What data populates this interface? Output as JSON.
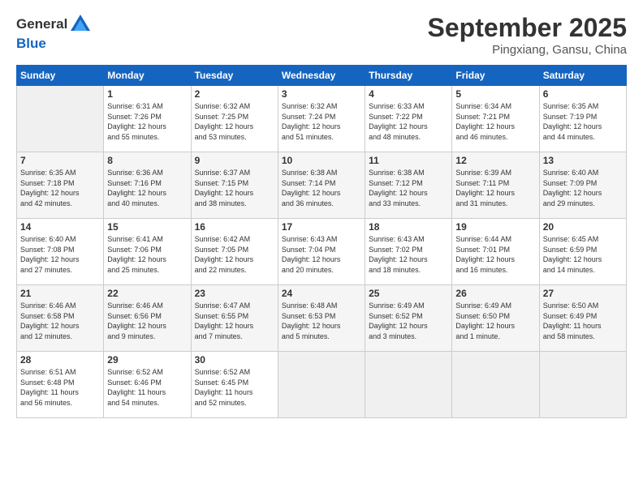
{
  "logo": {
    "line1": "General",
    "line2": "Blue"
  },
  "title": "September 2025",
  "subtitle": "Pingxiang, Gansu, China",
  "days_of_week": [
    "Sunday",
    "Monday",
    "Tuesday",
    "Wednesday",
    "Thursday",
    "Friday",
    "Saturday"
  ],
  "weeks": [
    [
      {
        "day": "",
        "info": ""
      },
      {
        "day": "1",
        "info": "Sunrise: 6:31 AM\nSunset: 7:26 PM\nDaylight: 12 hours\nand 55 minutes."
      },
      {
        "day": "2",
        "info": "Sunrise: 6:32 AM\nSunset: 7:25 PM\nDaylight: 12 hours\nand 53 minutes."
      },
      {
        "day": "3",
        "info": "Sunrise: 6:32 AM\nSunset: 7:24 PM\nDaylight: 12 hours\nand 51 minutes."
      },
      {
        "day": "4",
        "info": "Sunrise: 6:33 AM\nSunset: 7:22 PM\nDaylight: 12 hours\nand 48 minutes."
      },
      {
        "day": "5",
        "info": "Sunrise: 6:34 AM\nSunset: 7:21 PM\nDaylight: 12 hours\nand 46 minutes."
      },
      {
        "day": "6",
        "info": "Sunrise: 6:35 AM\nSunset: 7:19 PM\nDaylight: 12 hours\nand 44 minutes."
      }
    ],
    [
      {
        "day": "7",
        "info": "Sunrise: 6:35 AM\nSunset: 7:18 PM\nDaylight: 12 hours\nand 42 minutes."
      },
      {
        "day": "8",
        "info": "Sunrise: 6:36 AM\nSunset: 7:16 PM\nDaylight: 12 hours\nand 40 minutes."
      },
      {
        "day": "9",
        "info": "Sunrise: 6:37 AM\nSunset: 7:15 PM\nDaylight: 12 hours\nand 38 minutes."
      },
      {
        "day": "10",
        "info": "Sunrise: 6:38 AM\nSunset: 7:14 PM\nDaylight: 12 hours\nand 36 minutes."
      },
      {
        "day": "11",
        "info": "Sunrise: 6:38 AM\nSunset: 7:12 PM\nDaylight: 12 hours\nand 33 minutes."
      },
      {
        "day": "12",
        "info": "Sunrise: 6:39 AM\nSunset: 7:11 PM\nDaylight: 12 hours\nand 31 minutes."
      },
      {
        "day": "13",
        "info": "Sunrise: 6:40 AM\nSunset: 7:09 PM\nDaylight: 12 hours\nand 29 minutes."
      }
    ],
    [
      {
        "day": "14",
        "info": "Sunrise: 6:40 AM\nSunset: 7:08 PM\nDaylight: 12 hours\nand 27 minutes."
      },
      {
        "day": "15",
        "info": "Sunrise: 6:41 AM\nSunset: 7:06 PM\nDaylight: 12 hours\nand 25 minutes."
      },
      {
        "day": "16",
        "info": "Sunrise: 6:42 AM\nSunset: 7:05 PM\nDaylight: 12 hours\nand 22 minutes."
      },
      {
        "day": "17",
        "info": "Sunrise: 6:43 AM\nSunset: 7:04 PM\nDaylight: 12 hours\nand 20 minutes."
      },
      {
        "day": "18",
        "info": "Sunrise: 6:43 AM\nSunset: 7:02 PM\nDaylight: 12 hours\nand 18 minutes."
      },
      {
        "day": "19",
        "info": "Sunrise: 6:44 AM\nSunset: 7:01 PM\nDaylight: 12 hours\nand 16 minutes."
      },
      {
        "day": "20",
        "info": "Sunrise: 6:45 AM\nSunset: 6:59 PM\nDaylight: 12 hours\nand 14 minutes."
      }
    ],
    [
      {
        "day": "21",
        "info": "Sunrise: 6:46 AM\nSunset: 6:58 PM\nDaylight: 12 hours\nand 12 minutes."
      },
      {
        "day": "22",
        "info": "Sunrise: 6:46 AM\nSunset: 6:56 PM\nDaylight: 12 hours\nand 9 minutes."
      },
      {
        "day": "23",
        "info": "Sunrise: 6:47 AM\nSunset: 6:55 PM\nDaylight: 12 hours\nand 7 minutes."
      },
      {
        "day": "24",
        "info": "Sunrise: 6:48 AM\nSunset: 6:53 PM\nDaylight: 12 hours\nand 5 minutes."
      },
      {
        "day": "25",
        "info": "Sunrise: 6:49 AM\nSunset: 6:52 PM\nDaylight: 12 hours\nand 3 minutes."
      },
      {
        "day": "26",
        "info": "Sunrise: 6:49 AM\nSunset: 6:50 PM\nDaylight: 12 hours\nand 1 minute."
      },
      {
        "day": "27",
        "info": "Sunrise: 6:50 AM\nSunset: 6:49 PM\nDaylight: 11 hours\nand 58 minutes."
      }
    ],
    [
      {
        "day": "28",
        "info": "Sunrise: 6:51 AM\nSunset: 6:48 PM\nDaylight: 11 hours\nand 56 minutes."
      },
      {
        "day": "29",
        "info": "Sunrise: 6:52 AM\nSunset: 6:46 PM\nDaylight: 11 hours\nand 54 minutes."
      },
      {
        "day": "30",
        "info": "Sunrise: 6:52 AM\nSunset: 6:45 PM\nDaylight: 11 hours\nand 52 minutes."
      },
      {
        "day": "",
        "info": ""
      },
      {
        "day": "",
        "info": ""
      },
      {
        "day": "",
        "info": ""
      },
      {
        "day": "",
        "info": ""
      }
    ]
  ]
}
